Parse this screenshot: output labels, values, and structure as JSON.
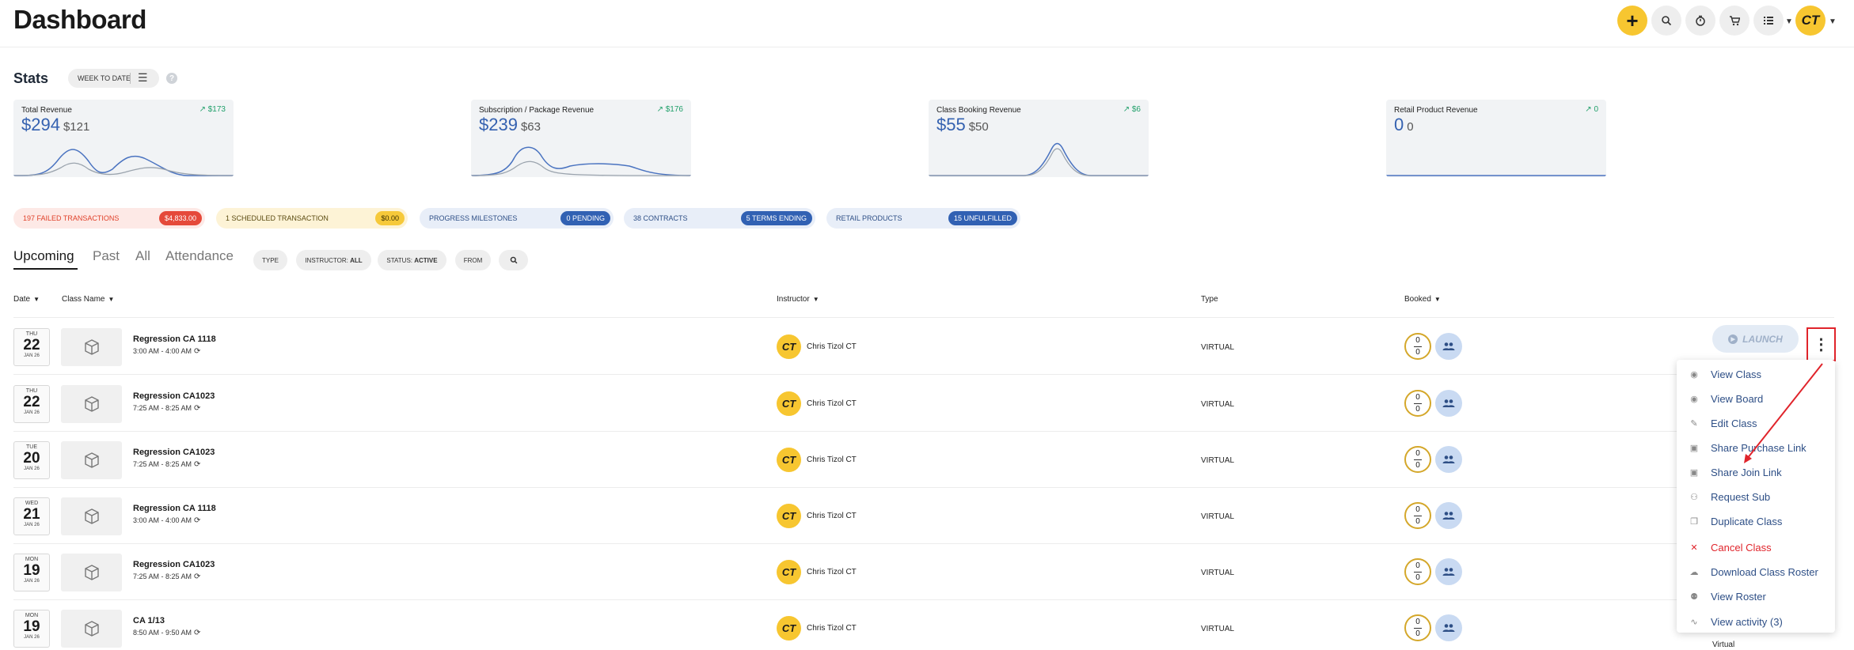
{
  "header": {
    "title": "Dashboard",
    "add_label": "+",
    "icons": [
      "plus-icon",
      "search-icon",
      "timer-icon",
      "cart-icon",
      "list-icon"
    ],
    "avatar": "CT"
  },
  "stats": {
    "title": "Stats",
    "filter_label": "WEEK TO DATE",
    "help": "?",
    "cards": [
      {
        "label": "Total Revenue",
        "value": "$294",
        "sub": "$121",
        "trend": "$173"
      },
      {
        "label": "Subscription / Package Revenue",
        "value": "$239",
        "sub": "$63",
        "trend": "$176"
      },
      {
        "label": "Class Booking Revenue",
        "value": "$55",
        "sub": "$50",
        "trend": "$6"
      },
      {
        "label": "Retail Product Revenue",
        "value": "0",
        "sub": "0",
        "trend": "0"
      }
    ]
  },
  "alerts": [
    {
      "label": "197 FAILED TRANSACTIONS",
      "count": "$4,833.00"
    },
    {
      "label": "1 SCHEDULED TRANSACTION",
      "count": "$0.00"
    },
    {
      "label": "PROGRESS MILESTONES",
      "count": "0 PENDING"
    },
    {
      "label": "38 CONTRACTS",
      "count": "5 TERMS ENDING"
    },
    {
      "label": "RETAIL PRODUCTS",
      "count": "15 UNFULFILLED"
    }
  ],
  "tabs": [
    "Upcoming",
    "Past",
    "All",
    "Attendance"
  ],
  "filters": {
    "type": "TYPE",
    "instructor_prefix": "INSTRUCTOR:",
    "instructor_value": "ALL",
    "status_prefix": "STATUS:",
    "status_value": "ACTIVE",
    "from": "FROM"
  },
  "table": {
    "headers": {
      "date": "Date",
      "class_name": "Class Name",
      "instructor": "Instructor",
      "type": "Type",
      "booked": "Booked"
    },
    "rows": [
      {
        "dow": "THU",
        "day": "22",
        "mon": "JAN 26",
        "name": "Regression CA 1118",
        "time": "3:00 AM - 4:00 AM",
        "instructor": "Chris Tizol CT",
        "initials": "CT",
        "type": "VIRTUAL",
        "booked_top": "0",
        "booked_bottom": "0"
      },
      {
        "dow": "THU",
        "day": "22",
        "mon": "JAN 26",
        "name": "Regression CA1023",
        "time": "7:25 AM - 8:25 AM",
        "instructor": "Chris Tizol CT",
        "initials": "CT",
        "type": "VIRTUAL",
        "booked_top": "0",
        "booked_bottom": "0"
      },
      {
        "dow": "TUE",
        "day": "20",
        "mon": "JAN 26",
        "name": "Regression CA1023",
        "time": "7:25 AM - 8:25 AM",
        "instructor": "Chris Tizol CT",
        "initials": "CT",
        "type": "VIRTUAL",
        "booked_top": "0",
        "booked_bottom": "0"
      },
      {
        "dow": "WED",
        "day": "21",
        "mon": "JAN 26",
        "name": "Regression CA 1118",
        "time": "3:00 AM - 4:00 AM",
        "instructor": "Chris Tizol CT",
        "initials": "CT",
        "type": "VIRTUAL",
        "booked_top": "0",
        "booked_bottom": "0"
      },
      {
        "dow": "MON",
        "day": "19",
        "mon": "JAN 26",
        "name": "Regression CA1023",
        "time": "7:25 AM - 8:25 AM",
        "instructor": "Chris Tizol CT",
        "initials": "CT",
        "type": "VIRTUAL",
        "booked_top": "0",
        "booked_bottom": "0"
      },
      {
        "dow": "MON",
        "day": "19",
        "mon": "JAN 26",
        "name": "CA 1/13",
        "time": "8:50 AM - 9:50 AM",
        "instructor": "Chris Tizol CT",
        "initials": "CT",
        "type": "VIRTUAL",
        "booked_top": "0",
        "booked_bottom": "0"
      }
    ]
  },
  "launch_label": "LAUNCH",
  "menu": [
    {
      "label": "View Class",
      "icon": "eye-icon"
    },
    {
      "label": "View Board",
      "icon": "eye-icon"
    },
    {
      "label": "Edit Class",
      "icon": "pencil-icon"
    },
    {
      "label": "Share Purchase Link",
      "icon": "share-icon"
    },
    {
      "label": "Share Join Link",
      "icon": "share-icon"
    },
    {
      "label": "Request Sub",
      "icon": "person-add-icon"
    },
    {
      "label": "Duplicate Class",
      "icon": "duplicate-icon"
    },
    {
      "label": "Cancel Class",
      "icon": "close-icon"
    },
    {
      "label": "Download Class Roster",
      "icon": "cloud-download-icon"
    },
    {
      "label": "View Roster",
      "icon": "group-icon"
    },
    {
      "label": "View activity (3)",
      "icon": "activity-icon"
    }
  ],
  "peek_type": "Virtual",
  "colors": {
    "accent": "#f7c630",
    "brand_blue": "#3461b0",
    "danger": "#e0242b",
    "success": "#22a06b"
  }
}
